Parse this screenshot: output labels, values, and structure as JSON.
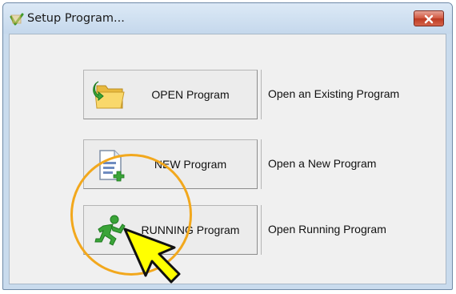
{
  "window": {
    "title": "Setup Program...",
    "icons": {
      "title": "setup-program-icon",
      "close": "close-icon"
    }
  },
  "options": [
    {
      "button_label": "OPEN Program",
      "description": "Open an Existing Program",
      "icon": "open-folder-icon"
    },
    {
      "button_label": "NEW Program",
      "description": "Open a New Program",
      "icon": "new-document-icon"
    },
    {
      "button_label": "RUNNING Program",
      "description": "Open Running Program",
      "icon": "running-man-icon"
    }
  ],
  "annotation": {
    "highlight_color": "#f2a81d",
    "pointer_color": "#ffff00",
    "pointer": "arrow-pointer-icon"
  }
}
